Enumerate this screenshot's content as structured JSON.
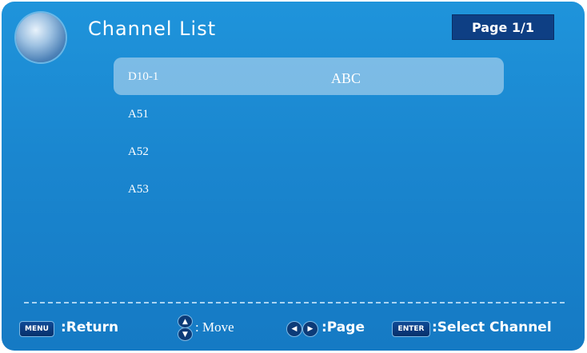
{
  "header": {
    "title": "Channel List",
    "page_indicator": "Page 1/1"
  },
  "channels": [
    {
      "number": "D10-1",
      "name": "ABC",
      "selected": true
    },
    {
      "number": "A51",
      "name": "",
      "selected": false
    },
    {
      "number": "A52",
      "name": "",
      "selected": false
    },
    {
      "number": "A53",
      "name": "",
      "selected": false
    }
  ],
  "footer": {
    "menu_key": "MENU",
    "return_label": ":Return",
    "move_label": ": Move",
    "page_label": ":Page",
    "enter_key": "ENTER",
    "select_label": ":Select Channel"
  },
  "colors": {
    "background": "#1a86cf",
    "selected_row": "#afd4ee",
    "badge": "#0e3f84"
  },
  "icons": [
    "globe-icon",
    "up-down-arrows-icon",
    "left-right-arrows-icon"
  ]
}
